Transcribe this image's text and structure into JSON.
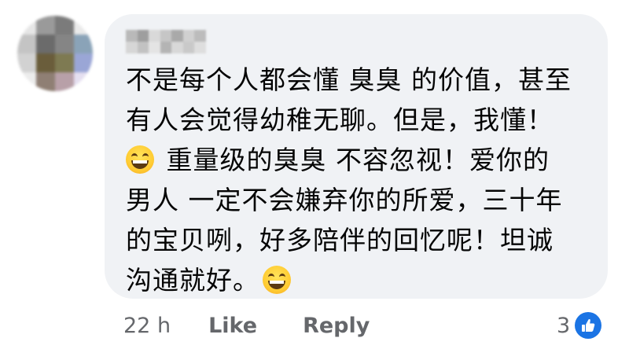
{
  "comment": {
    "lines": [
      "不是每个人都会懂 臭臭 的价值，甚至",
      "有人会觉得幼稚无聊。但是，我懂！",
      "重量级的臭臭 不容忽视！爱你的",
      "男人 一定不会嫌弃你的所爱，三十年",
      "的宝贝咧，好多陪伴的回忆呢！坦诚",
      "沟通就好。"
    ],
    "emoji": "grinning-face-with-smiling-eyes"
  },
  "actions": {
    "time": "22 h",
    "like_label": "Like",
    "reply_label": "Reply"
  },
  "reactions": {
    "count": "3",
    "icon": "thumbs-up-icon"
  },
  "colors": {
    "bubble": "#f0f2f5",
    "text": "#050505",
    "secondary": "#65676b",
    "like_blue": "#1b74e4"
  }
}
